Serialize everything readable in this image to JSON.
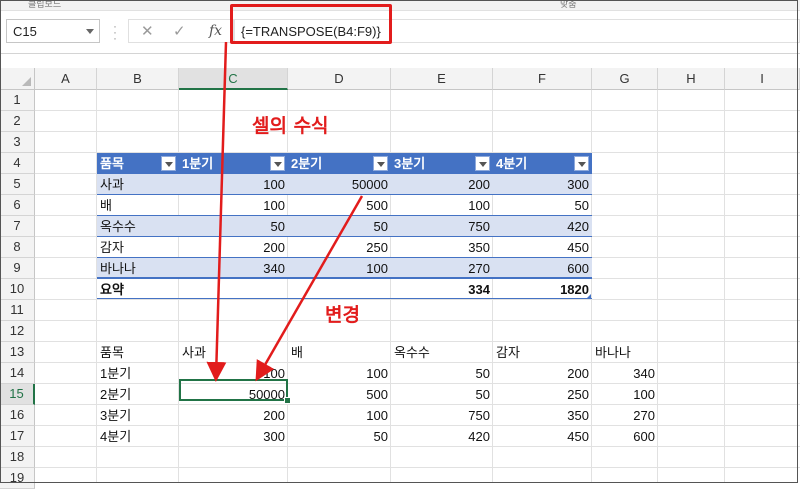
{
  "ribbon_fragments": [
    "클립보드",
    "맞춤"
  ],
  "formula_bar": {
    "name_box": "C15",
    "cancel_icon": "✕",
    "enter_icon": "✓",
    "fx_label": "fx",
    "formula": "{=TRANSPOSE(B4:F9)}"
  },
  "columns": [
    "A",
    "B",
    "C",
    "D",
    "E",
    "F",
    "G",
    "H",
    "I"
  ],
  "rows": [
    "1",
    "2",
    "3",
    "4",
    "5",
    "6",
    "7",
    "8",
    "9",
    "10",
    "11",
    "12",
    "13",
    "14",
    "15",
    "16",
    "17",
    "18",
    "19"
  ],
  "selected_cell": {
    "column": "C",
    "row": "15"
  },
  "table1": {
    "headers": [
      "품목",
      "1분기",
      "2분기",
      "3분기",
      "4분기"
    ],
    "rows": [
      [
        "사과",
        "100",
        "50000",
        "200",
        "300"
      ],
      [
        "배",
        "100",
        "500",
        "100",
        "50"
      ],
      [
        "옥수수",
        "50",
        "50",
        "750",
        "420"
      ],
      [
        "감자",
        "200",
        "250",
        "350",
        "450"
      ],
      [
        "바나나",
        "340",
        "100",
        "270",
        "600"
      ]
    ],
    "total_row": [
      "요약",
      "",
      "",
      "334",
      "1820"
    ]
  },
  "table2": {
    "headers": [
      "품목",
      "사과",
      "배",
      "옥수수",
      "감자",
      "바나나"
    ],
    "rows": [
      [
        "1분기",
        "100",
        "100",
        "50",
        "200",
        "340"
      ],
      [
        "2분기",
        "50000",
        "500",
        "50",
        "250",
        "100"
      ],
      [
        "3분기",
        "200",
        "100",
        "750",
        "350",
        "270"
      ],
      [
        "4분기",
        "300",
        "50",
        "420",
        "450",
        "600"
      ]
    ]
  },
  "annotations": {
    "formula_label": "셀의 수식",
    "change_label": "변경"
  },
  "colors": {
    "annotation_red": "#e21c1c",
    "table_header_blue": "#4472c4",
    "table_band": "#d9e1f2",
    "excel_green": "#217346"
  }
}
